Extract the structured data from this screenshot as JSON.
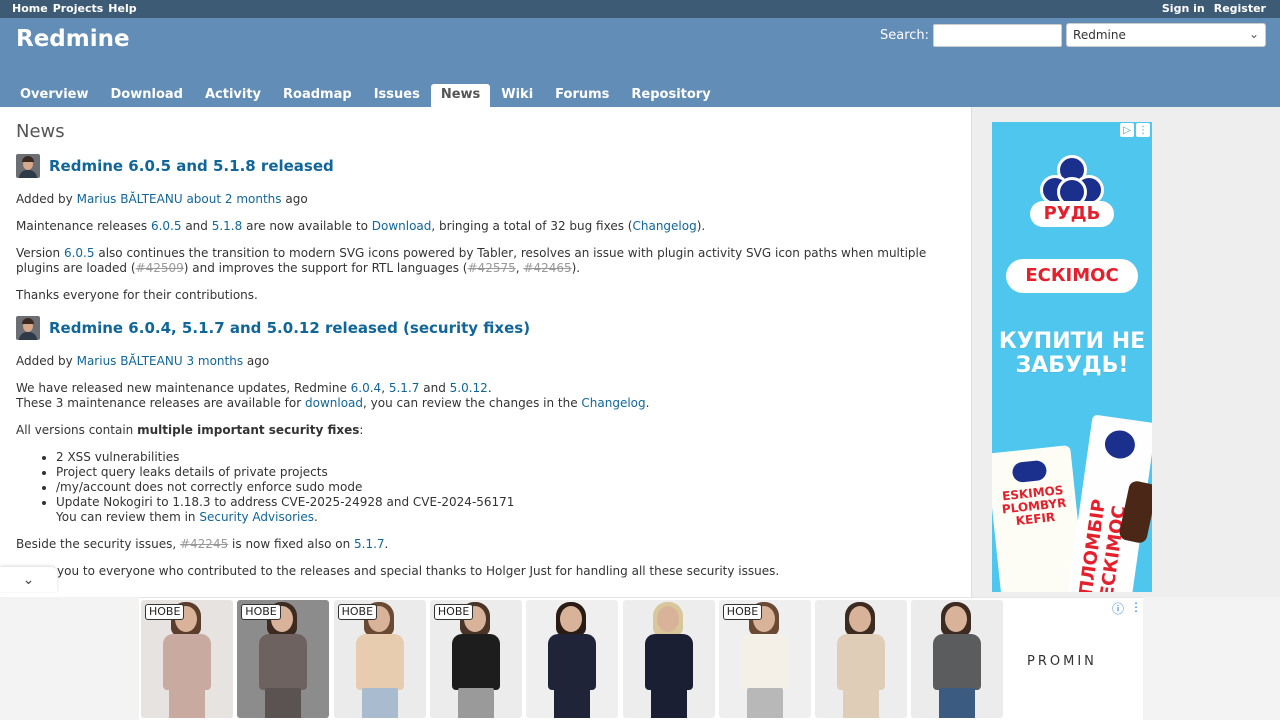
{
  "top_menu": {
    "home": "Home",
    "projects": "Projects",
    "help": "Help",
    "sign_in": "Sign in",
    "register": "Register"
  },
  "header": {
    "title": "Redmine",
    "search_label": "Search:",
    "search_value": "",
    "project_select": "Redmine"
  },
  "main_menu": [
    "Overview",
    "Download",
    "Activity",
    "Roadmap",
    "Issues",
    "News",
    "Wiki",
    "Forums",
    "Repository"
  ],
  "content": {
    "heading": "News",
    "news1": {
      "title": "Redmine 6.0.5 and 5.1.8 released",
      "added_by": "Added by",
      "author": "Marius BĂLTEANU",
      "ago_link": "about 2 months",
      "ago": "ago",
      "p1_a": "Maintenance releases",
      "p1_v1": "6.0.5",
      "p1_and": "and",
      "p1_v2": "5.1.8",
      "p1_b": "are now available to",
      "p1_dl": "Download",
      "p1_c": ", bringing a total of 32 bug fixes (",
      "p1_cl": "Changelog",
      "p1_d": ").",
      "p2_a": "Version",
      "p2_v": "6.0.5",
      "p2_b": "also continues the transition to modern SVG icons powered by Tabler, resolves an issue with plugin activity SVG icon paths when multiple",
      "p2_c": "plugins are loaded (",
      "p2_i1": "#42509",
      "p2_d": ") and improves the support for RTL languages (",
      "p2_i2": "#42575",
      "p2_comma": ", ",
      "p2_i3": "#42465",
      "p2_e": ").",
      "p3": "Thanks everyone for their contributions."
    },
    "news2": {
      "title": "Redmine 6.0.4, 5.1.7 and 5.0.12 released (security fixes)",
      "added_by": "Added by",
      "author": "Marius BĂLTEANU",
      "ago_link": "3 months",
      "ago": "ago",
      "p1_a": "We have released new maintenance updates, Redmine",
      "p1_v1": "6.0.4",
      "p1_sep": ",",
      "p1_v2": "5.1.7",
      "p1_and": "and",
      "p1_v3": "5.0.12",
      "p1_dot": ".",
      "p2_a": "These 3 maintenance releases are available for",
      "p2_dl": "download",
      "p2_b": ", you can review the changes in the",
      "p2_cl": "Changelog",
      "p2_dot": ".",
      "p3_a": "All versions contain",
      "p3_b": "multiple important security fixes",
      "p3_c": ":",
      "items": [
        "2 XSS vulnerabilities",
        "Project query leaks details of private projects",
        "/my/account does not correctly enforce sudo mode",
        "Update Nokogiri to 1.18.3 to address CVE-2025-24928 and CVE-2024-56171"
      ],
      "review_a": "You can review them in",
      "review_link": "Security Advisories",
      "review_dot": ".",
      "p4_a": "Beside the security issues,",
      "p4_issue": "#42245",
      "p4_b": "is now fixed also on",
      "p4_v": "5.1.7",
      "p4_dot": ".",
      "p5": "you to everyone who contributed to the releases and special thanks to Holger Just for handling all these security issues."
    }
  },
  "side_ad": {
    "brand": "РУДЬ",
    "product": "ЕСКІМОС",
    "slogan": "КУПИТИ НЕ ЗАБУДЬ!",
    "pack1_text": "ESKIMOS PLOMBYR KEFIR",
    "pack2_text": "ПЛОМБІР ЕСКІМОС"
  },
  "bottom_ad": {
    "badge": "НОВЕ",
    "brand": "PROMIN",
    "products": [
      {
        "badge": true,
        "bg": "#e6e3e1",
        "hair": "#5a3d2b",
        "top": "#c9aaa0",
        "legs": "#c9aaa0"
      },
      {
        "badge": true,
        "bg": "#8c8c8c",
        "hair": "#3d2a20",
        "top": "#6e6260",
        "legs": "#5b5352"
      },
      {
        "badge": true,
        "bg": "#ebebeb",
        "hair": "#6b4a34",
        "top": "#e8ccb0",
        "legs": "#a9bccf"
      },
      {
        "badge": true,
        "bg": "#ececec",
        "hair": "#4a3428",
        "top": "#1d1d1d",
        "legs": "#9a9a9a"
      },
      {
        "badge": false,
        "bg": "#efefef",
        "hair": "#2a1c14",
        "top": "#1f2438",
        "legs": "#1f2438"
      },
      {
        "badge": false,
        "bg": "#ededed",
        "hair": "#d8c79a",
        "top": "#1b1f33",
        "legs": "#1b1f33"
      },
      {
        "badge": true,
        "bg": "#efefef",
        "hair": "#6b4a34",
        "top": "#f4f0e8",
        "legs": "#b8b8b8"
      },
      {
        "badge": false,
        "bg": "#ededed",
        "hair": "#3d2a20",
        "top": "#e0cdb7",
        "legs": "#e0cdb7"
      },
      {
        "badge": false,
        "bg": "#ececec",
        "hair": "#3d2a20",
        "top": "#5a5c5e",
        "legs": "#3c5b80"
      }
    ]
  }
}
